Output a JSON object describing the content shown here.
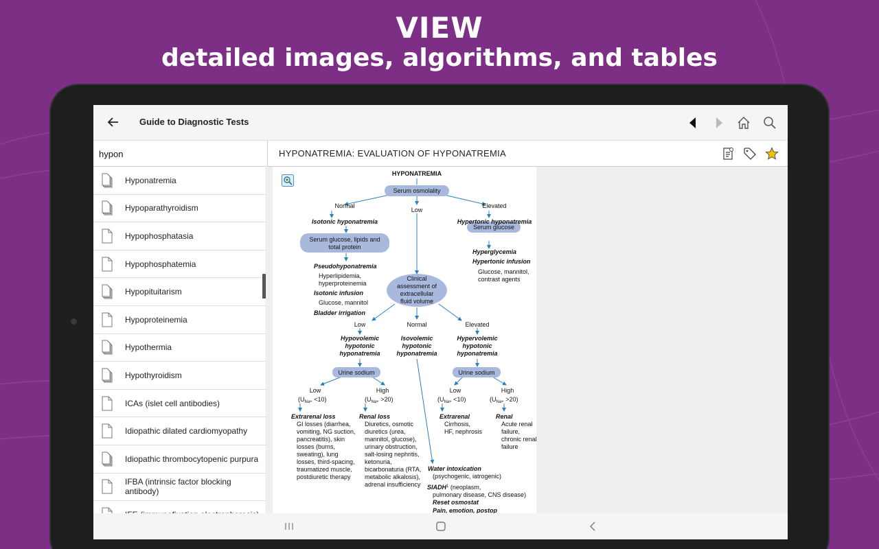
{
  "promo": {
    "headline": "VIEW",
    "subheadline": "detailed images, algorithms, and tables"
  },
  "appbar": {
    "title": "Guide to Diagnostic Tests"
  },
  "search": {
    "value": "hypon"
  },
  "results": [
    {
      "label": "Hyponatremia",
      "icon": "multi-doc-icon"
    },
    {
      "label": "Hypoparathyroidism",
      "icon": "multi-doc-icon"
    },
    {
      "label": "Hypophosphatasia",
      "icon": "doc-icon"
    },
    {
      "label": "Hypophosphatemia",
      "icon": "doc-icon"
    },
    {
      "label": "Hypopituitarism",
      "icon": "multi-doc-icon"
    },
    {
      "label": "Hypoproteinemia",
      "icon": "doc-icon"
    },
    {
      "label": "Hypothermia",
      "icon": "multi-doc-icon"
    },
    {
      "label": "Hypothyroidism",
      "icon": "multi-doc-icon"
    },
    {
      "label": "ICAs (islet cell antibodies)",
      "icon": "doc-icon"
    },
    {
      "label": "Idiopathic dilated cardiomyopathy",
      "icon": "doc-icon"
    },
    {
      "label": "Idiopathic thrombocytopenic purpura",
      "icon": "multi-doc-icon"
    },
    {
      "label": "IFBA (intrinsic factor blocking antibody)",
      "icon": "doc-icon"
    },
    {
      "label": "IFE (immunofixation electrophoresis)",
      "icon": "doc-icon"
    }
  ],
  "detail": {
    "title": "HYPONATREMIA: EVALUATION OF HYPONATREMIA"
  },
  "algorithm": {
    "root": "HYPONATREMIA",
    "serum_osm": "Serum osmolality",
    "branch_normal": "Normal",
    "branch_low": "Low",
    "branch_elevated": "Elevated",
    "isotonic": "Isotonic hyponatremia",
    "hypertonic": "Hypertonic hyponatremia",
    "serum_glucose_lipids_1": "Serum glucose, lipids and",
    "serum_glucose_lipids_2": "total protein",
    "serum_glucose": "Serum glucose",
    "pseudo": "Pseudohyponatremia",
    "hyperlipidemia": "Hyperlipidemia,",
    "hyperproteinemia": "hyperproteinemia",
    "isotonic_infusion": "Isotonic infusion",
    "glucose_mannitol": "Glucose, mannitol",
    "bladder": "Bladder irrigation",
    "hyperglycemia": "Hyperglycemia",
    "hypertonic_infusion": "Hypertonic infusion",
    "glucose_mannitol2": "Glucose, mannitol,",
    "contrast": "contrast agents",
    "clinical_1": "Clinical",
    "clinical_2": "assessment of",
    "clinical_3": "extracellular",
    "clinical_4": "fluid volume",
    "vol_low": "Low",
    "vol_normal": "Normal",
    "vol_elevated": "Elevated",
    "hypovolemic_1": "Hypovolemic",
    "hypovolemic_2": "hypotonic",
    "hypovolemic_3": "hyponatremia",
    "isovolemic_1": "Isovolemic",
    "isovolemic_2": "hypotonic",
    "isovolemic_3": "hyponatremia",
    "hypervolemic_1": "Hypervolemic",
    "hypervolemic_2": "hypotonic",
    "hypervolemic_3": "hyponatremia",
    "urine_sodium": "Urine sodium",
    "u_low": "Low",
    "u_high": "High",
    "u_low_val_a": "(U",
    "u_sub": "Na+",
    "u_low_val_b": " <10)",
    "u_high_val_b": " >20)",
    "extrarenal_loss": "Extrarenal loss",
    "extrarenal_lines": [
      "GI losses (diarrhea,",
      "vomiting,  NG suction,",
      "pancreatitis), skin",
      "losses (burns,",
      "sweating), lung",
      "losses, third-spacing,",
      "traumatized muscle,",
      "postdiuretic therapy"
    ],
    "renal_loss": "Renal loss",
    "renal_lines": [
      "Diuretics, osmotic",
      "diuretics (urea,",
      "mannitol, glucose),",
      "urinary obstruction,",
      "salt-losing nephritis,",
      "ketonuria,",
      "bicarbonaturia (RTA,",
      "metabolic alkalosis),",
      "adrenal insufficiency"
    ],
    "extrarenal": "Extrarenal",
    "extrarenal2_lines": [
      "Cirrhosis,",
      "HF, nephrosis"
    ],
    "renal": "Renal",
    "renal2_lines": [
      "Acute renal",
      "failure,",
      "chronic renal",
      "failure"
    ],
    "water_intox": "Water intoxication",
    "water_intox_sub": "(psychogenic,  iatrogenic)",
    "siadh": "SIADH",
    "siadh_sup": "1",
    "siadh_rest": " (neoplasm,",
    "siadh_line2": "pulmonary disease, CNS disease)",
    "reset": "Reset osmostat",
    "pain": "Pain, emotion, postop"
  }
}
